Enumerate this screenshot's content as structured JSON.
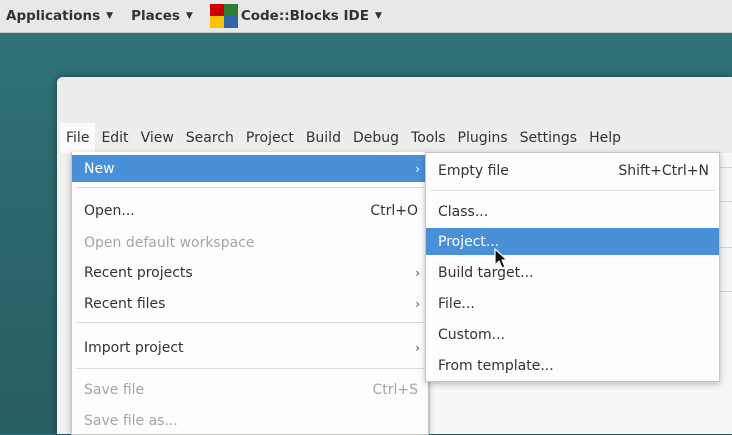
{
  "top_panel": {
    "applications_label": "Applications",
    "places_label": "Places",
    "app_label": "Code::Blocks IDE",
    "arrow": "▼"
  },
  "menubar": {
    "items": [
      "File",
      "Edit",
      "View",
      "Search",
      "Project",
      "Build",
      "Debug",
      "Tools",
      "Plugins",
      "Settings",
      "Help"
    ]
  },
  "file_menu": {
    "items": [
      {
        "label": "New",
        "accel": "",
        "submenu": true,
        "disabled": false,
        "selected": true
      },
      {
        "label": "Open...",
        "accel": "Ctrl+O",
        "submenu": false,
        "disabled": false
      },
      {
        "label": "Open default workspace",
        "accel": "",
        "submenu": false,
        "disabled": true
      },
      {
        "label": "Recent projects",
        "accel": "",
        "submenu": true,
        "disabled": false
      },
      {
        "label": "Recent files",
        "accel": "",
        "submenu": true,
        "disabled": false
      },
      {
        "label": "Import project",
        "accel": "",
        "submenu": true,
        "disabled": false
      },
      {
        "label": "Save file",
        "accel": "Ctrl+S",
        "submenu": false,
        "disabled": true
      },
      {
        "label": "Save file as...",
        "accel": "",
        "submenu": false,
        "disabled": true
      }
    ],
    "chevron": "›"
  },
  "new_menu": {
    "items": [
      {
        "label": "Empty file",
        "accel": "Shift+Ctrl+N",
        "selected": false
      },
      {
        "label": "Class...",
        "accel": "",
        "selected": false
      },
      {
        "label": "Project...",
        "accel": "",
        "selected": true
      },
      {
        "label": "Build target...",
        "accel": "",
        "selected": false
      },
      {
        "label": "File...",
        "accel": "",
        "selected": false
      },
      {
        "label": "Custom...",
        "accel": "",
        "selected": false
      },
      {
        "label": "From template...",
        "accel": "",
        "selected": false
      }
    ]
  },
  "colors": {
    "selection": "#4a90d9",
    "desktop": "#2d6b70",
    "disabled_text": "#a4a6a2"
  },
  "icons": [
    "codeblocks-logo-icon",
    "chevron-right-icon",
    "mouse-pointer-icon",
    "dropdown-arrow-icon"
  ]
}
